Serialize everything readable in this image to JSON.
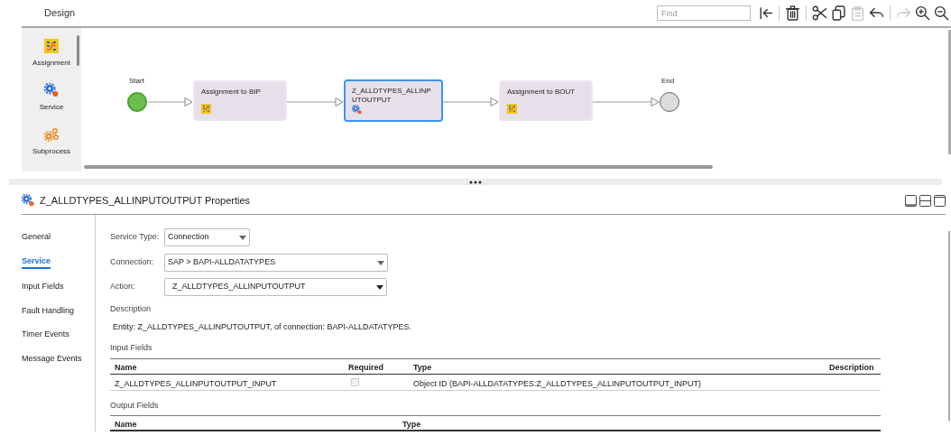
{
  "header": {
    "title": "Design",
    "find": {
      "placeholder": "Find"
    },
    "tools": [
      {
        "kind": "first",
        "disabled": false
      },
      {
        "kind": "delete",
        "disabled": false
      },
      {
        "kind": "cut",
        "disabled": false
      },
      {
        "kind": "copy",
        "disabled": false
      },
      {
        "kind": "paste",
        "disabled": true
      },
      {
        "kind": "undo",
        "disabled": false
      },
      {
        "kind": "redo",
        "disabled": true
      },
      {
        "kind": "zoomin",
        "disabled": false
      },
      {
        "kind": "zoomout",
        "disabled": false
      }
    ]
  },
  "palette": [
    {
      "kind": "assignment",
      "label": "Assignment"
    },
    {
      "kind": "service",
      "label": "Service"
    },
    {
      "kind": "subprocess",
      "label": "Subprocess"
    }
  ],
  "diagram": {
    "nodes": [
      {
        "kind": "start",
        "label": "Start"
      },
      {
        "kind": "assignment",
        "label": "Assignment to BIP",
        "selected": false
      },
      {
        "kind": "service",
        "label": "Z_ALLDTYPES_ALLINPUTOUTPUT",
        "selected": true
      },
      {
        "kind": "assignment",
        "label": "Assignment to BOUT",
        "selected": false
      },
      {
        "kind": "end",
        "label": "End"
      }
    ]
  },
  "properties": {
    "title": "Z_ALLDTYPES_ALLINPUTOUTPUT Properties",
    "nav": [
      {
        "label": "General",
        "selected": false
      },
      {
        "label": "Service",
        "selected": true
      },
      {
        "label": "Input Fields",
        "selected": false
      },
      {
        "label": "Fault Handling",
        "selected": false
      },
      {
        "label": "Timer Events",
        "selected": false
      },
      {
        "label": "Message Events",
        "selected": false
      }
    ],
    "service_type": {
      "label": "Service Type:",
      "value": "Connection"
    },
    "connection": {
      "label": "Connection:",
      "value": "SAP > BAPI-ALLDATATYPES"
    },
    "action": {
      "label": "Action:",
      "value": "Z_ALLDTYPES_ALLINPUTOUTPUT"
    },
    "description": {
      "label": "Description",
      "text": "Entity: Z_ALLDTYPES_ALLINPUTOUTPUT, of connection: BAPI-ALLDATATYPES."
    },
    "input_fields": {
      "label": "Input Fields",
      "columns": [
        "Name",
        "Required",
        "Type",
        "Description"
      ],
      "rows": [
        {
          "name": "Z_ALLDTYPES_ALLINPUTOUTPUT_INPUT",
          "required": false,
          "type": "Object ID (BAPI-ALLDATATYPES:Z_ALLDTYPES_ALLINPUTOUTPUT_INPUT)"
        }
      ]
    },
    "output_fields": {
      "label": "Output Fields",
      "columns": [
        "Name",
        "Type"
      ]
    }
  }
}
